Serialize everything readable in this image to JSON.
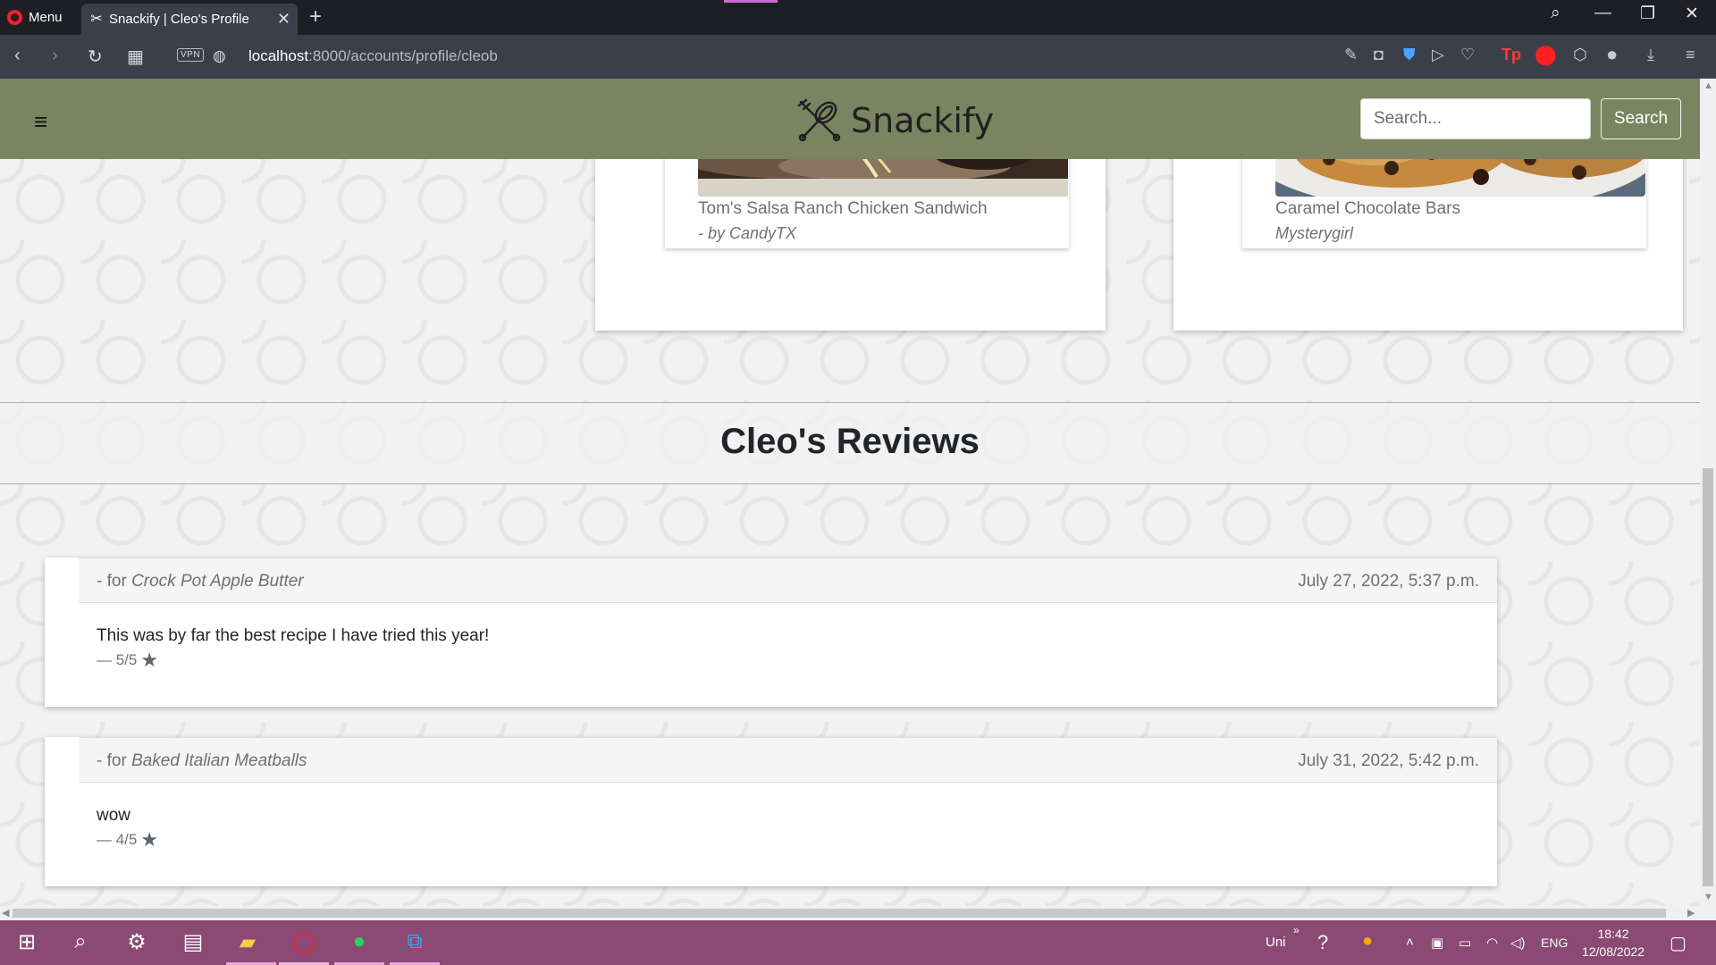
{
  "browser": {
    "menu_label": "Menu",
    "tab_title": "Snackify | Cleo's Profile",
    "url_host": "localhost",
    "url_path": ":8000/accounts/profile/cleob",
    "vpn_label": "VPN"
  },
  "navbar": {
    "brand": "Snackify",
    "search_placeholder": "Search...",
    "search_button": "Search"
  },
  "recipes": [
    {
      "title": "Tom's Salsa Ranch Chicken Sandwich",
      "author": "- by CandyTX"
    },
    {
      "title": "Caramel Chocolate Bars",
      "author": "Mysterygirl"
    }
  ],
  "reviews_section": {
    "title": "Cleo's Reviews",
    "reviews": [
      {
        "for_prefix": "- for ",
        "recipe": "Crock Pot Apple Butter",
        "date": "July 27, 2022, 5:37 p.m.",
        "text": "This was by far the best recipe I have tried this year!",
        "rating": "— 5/5"
      },
      {
        "for_prefix": "- for ",
        "recipe": "Baked Italian Meatballs",
        "date": "July 31, 2022, 5:42 p.m.",
        "text": "wow",
        "rating": "— 4/5"
      }
    ]
  },
  "taskbar": {
    "tray_text": "Uni",
    "language": "ENG",
    "time": "18:42",
    "date": "12/08/2022"
  },
  "colors": {
    "navbar_bg": "#7b8460",
    "taskbar_bg": "#8b4a73",
    "browser_chrome": "#3b3f4a"
  }
}
